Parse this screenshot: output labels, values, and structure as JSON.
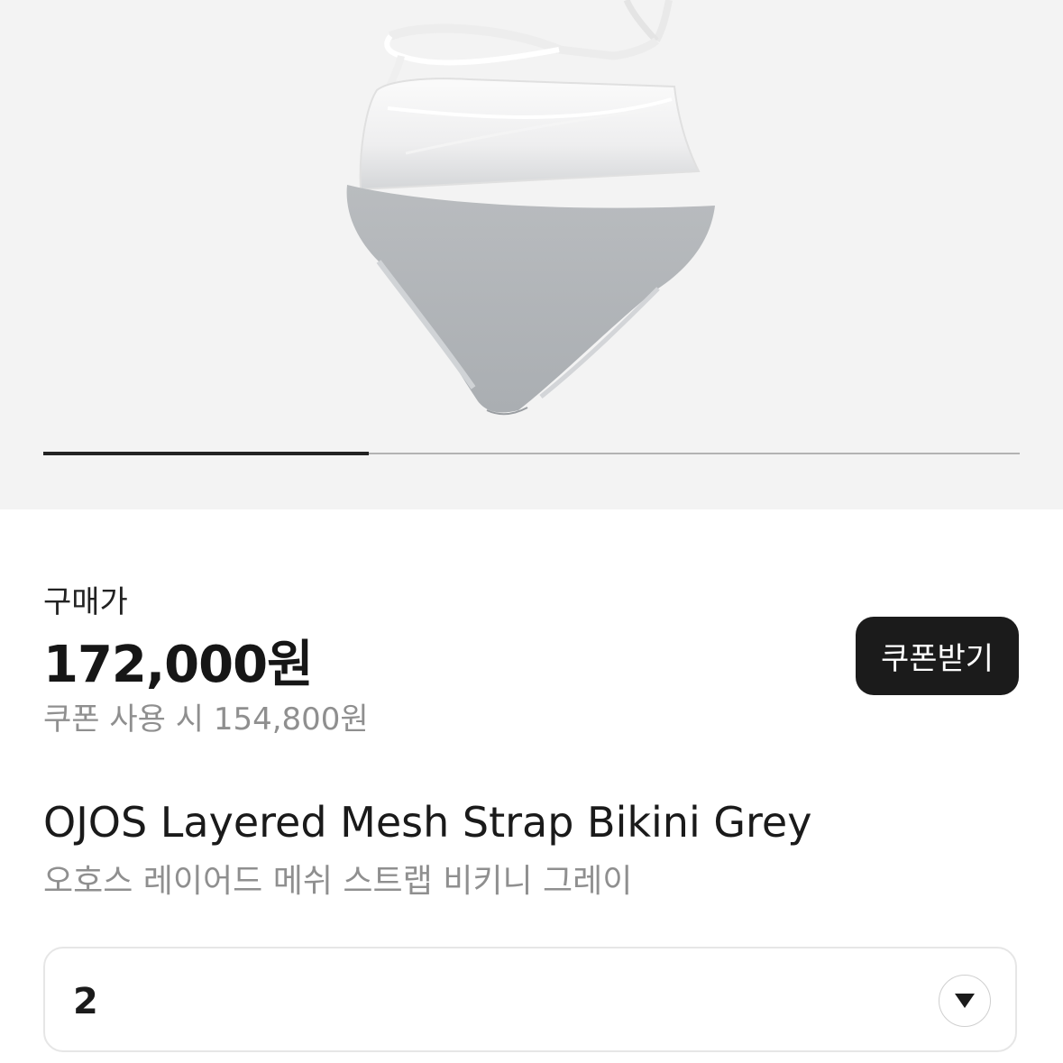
{
  "product_image": {
    "icon": "bikini-product-image",
    "gallery_progress": 0.333
  },
  "price": {
    "label": "구매가",
    "amount": "172,000원",
    "coupon_price": "쿠폰 사용 시 154,800원"
  },
  "coupon_button": {
    "label": "쿠폰받기"
  },
  "product": {
    "name": "OJOS Layered Mesh Strap Bikini Grey",
    "name_ko": "오호스 레이어드 메쉬 스트랩 비키니 그레이"
  },
  "option_select": {
    "value": "2",
    "icon": "chevron-down-icon"
  }
}
